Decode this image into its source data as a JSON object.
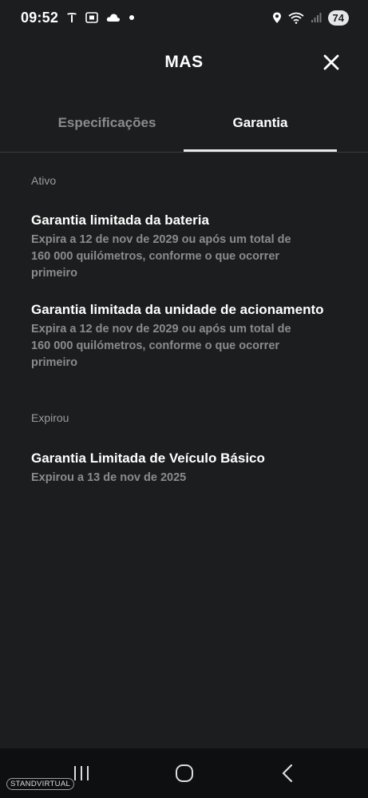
{
  "status_bar": {
    "time": "09:52",
    "battery": "74",
    "icons": [
      "tesla-icon",
      "screenshot-icon",
      "cloud-icon",
      "dot-icon",
      "location-icon",
      "wifi-icon",
      "signal-icon"
    ]
  },
  "header": {
    "title": "MAS",
    "close_icon": "close-icon"
  },
  "tabs": [
    {
      "label": "Especificações",
      "active": false
    },
    {
      "label": "Garantia",
      "active": true
    }
  ],
  "sections": {
    "active": {
      "label": "Ativo",
      "items": [
        {
          "title": "Garantia limitada da bateria",
          "desc": [
            "Expira a 12 de nov de 2029 ou após um total de",
            "160 000 quilómetros, conforme o que ocorrer",
            "primeiro"
          ]
        },
        {
          "title": "Garantia limitada da unidade de acionamento",
          "desc": [
            "Expira a 12 de nov de 2029 ou após um total de",
            "160 000 quilómetros, conforme o que ocorrer",
            "primeiro"
          ]
        }
      ]
    },
    "expired": {
      "label": "Expirou",
      "items": [
        {
          "title": "Garantia Limitada de Veículo Básico",
          "desc": [
            "Expirou a 13 de nov de 2025"
          ]
        }
      ]
    }
  },
  "watermark": "STANDVIRTUAL",
  "colors": {
    "background": "#1c1d1f",
    "text_primary": "#ffffff",
    "text_secondary": "#8a8b8e",
    "nav_bar": "#0e0f10"
  }
}
